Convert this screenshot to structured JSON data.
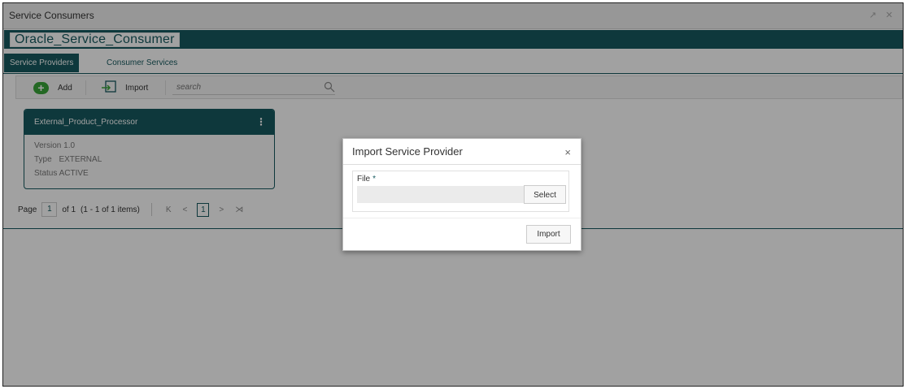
{
  "window": {
    "title": "Service Consumers",
    "controls": "↗ ✕"
  },
  "consumer": {
    "name": "Oracle_Service_Consumer"
  },
  "tabs": [
    {
      "label": "Service Providers",
      "active": true
    },
    {
      "label": "Consumer Services",
      "active": false
    }
  ],
  "toolbar": {
    "add_label": "Add",
    "import_label": "Import",
    "search_placeholder": "search"
  },
  "cards": [
    {
      "title": "External_Product_Processor",
      "menu_icon": "kebab-menu-icon",
      "rows": [
        {
          "label": "Version",
          "value": "1.0"
        },
        {
          "label": "Type",
          "value": "EXTERNAL"
        },
        {
          "label": "Status",
          "value": "ACTIVE"
        }
      ]
    }
  ],
  "pager": {
    "page_label": "Page",
    "page_value": "1",
    "of_label": "of 1",
    "items_label": "(1 - 1 of 1 items)",
    "first": "K",
    "prev": "<",
    "current": "1",
    "next": ">",
    "last": "⋊"
  },
  "modal": {
    "title": "Import Service Provider",
    "close": "×",
    "file_label": "File",
    "required_marker": "*",
    "select_label": "Select",
    "import_label": "Import"
  },
  "colors": {
    "accent": "#175a5f",
    "add_green": "#3aa53a"
  }
}
